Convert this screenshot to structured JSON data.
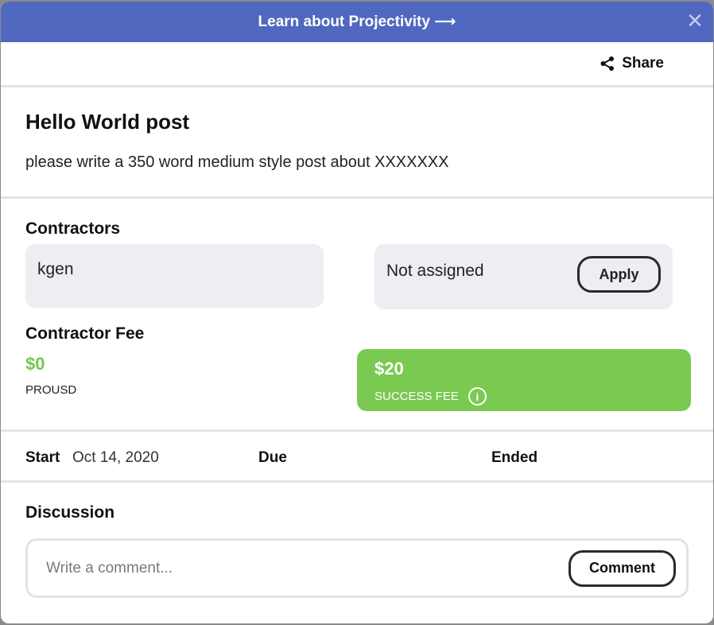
{
  "banner": {
    "text": "Learn about Projectivity ⟶",
    "close_glyph": "✕"
  },
  "toolbar": {
    "share_label": "Share",
    "share_icon": "share-icon"
  },
  "post": {
    "title": "Hello World post",
    "description": "please write a 350 word medium style post about XXXXXXX"
  },
  "contractors": {
    "heading": "Contractors",
    "assigned_name": "kgen",
    "unassigned_label": "Not assigned",
    "apply_label": "Apply"
  },
  "fee": {
    "heading": "Contractor Fee",
    "amount": "$0",
    "currency": "PROUSD",
    "success_amount": "$20",
    "success_label": "SUCCESS FEE",
    "info_glyph": "i"
  },
  "dates": {
    "start_label": "Start",
    "start_value": "Oct 14, 2020",
    "due_label": "Due",
    "ended_label": "Ended"
  },
  "discussion": {
    "heading": "Discussion",
    "placeholder": "Write a comment...",
    "comment_label": "Comment"
  },
  "colors": {
    "banner": "#5068c0",
    "success": "#7ac951",
    "fee_amount": "#74c74f",
    "card": "#eeeef2"
  }
}
